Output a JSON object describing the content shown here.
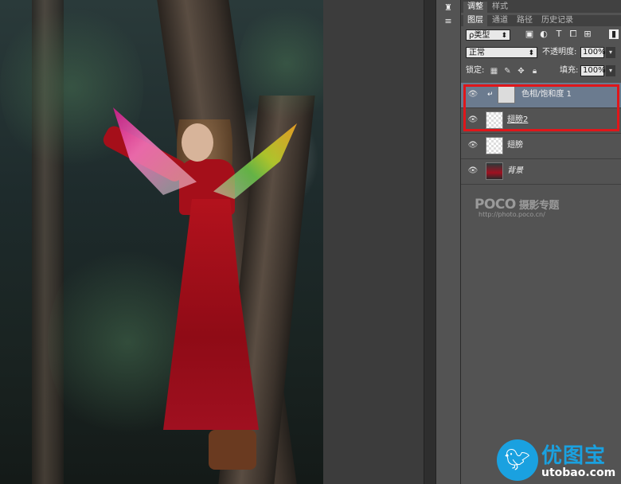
{
  "panel_tabs_top": [
    "调整",
    "样式"
  ],
  "panel_tabs": [
    "图层",
    "通道",
    "路径",
    "历史记录"
  ],
  "filter": {
    "value": "ρ类型",
    "icons": [
      "image-filter-icon",
      "adjustment-filter-icon",
      "type-filter-icon",
      "shape-filter-icon",
      "smart-object-filter-icon"
    ]
  },
  "blend_mode": "正常",
  "opacity": {
    "label": "不透明度:",
    "value": "100%"
  },
  "lock": {
    "label": "锁定:"
  },
  "fill": {
    "label": "填充:",
    "value": "100%"
  },
  "layers": [
    {
      "name": "色相/饱和度 1",
      "type": "adjustment",
      "selected": true
    },
    {
      "name": "翅膀2",
      "type": "pixel",
      "selected": false
    },
    {
      "name": "翅膀",
      "type": "pixel",
      "selected": false
    },
    {
      "name": "背景",
      "type": "background",
      "selected": false
    }
  ],
  "watermark": {
    "brand": "POCO",
    "brand_cn": "摄影专题",
    "url": "http://photo.poco.cn/"
  },
  "site_logo": {
    "cn": "优图宝",
    "en": "utobao.com"
  },
  "colors": {
    "selection_highlight": "#e0161a",
    "selected_layer": "#6b7b8f",
    "logo_blue": "#1aa1e0"
  }
}
